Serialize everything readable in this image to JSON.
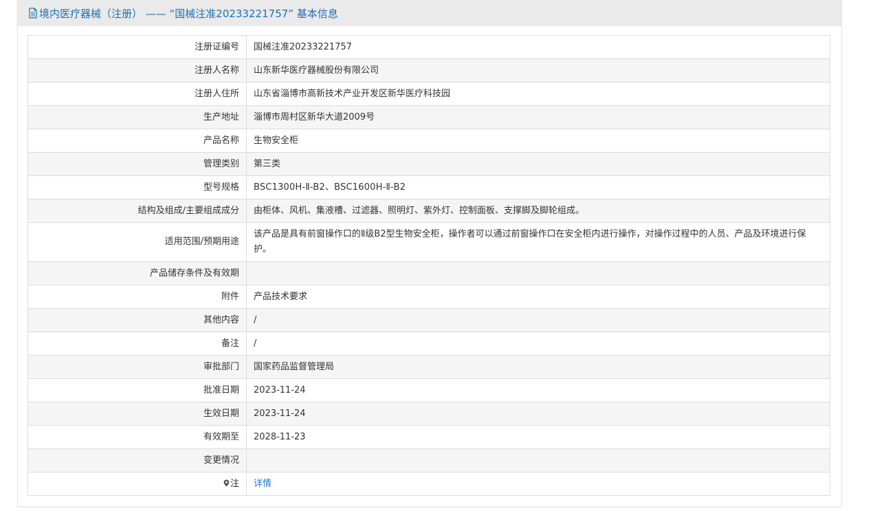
{
  "header": {
    "icon": "document-icon",
    "title": "境内医疗器械（注册） —— “国械注准20233221757” 基本信息"
  },
  "rows": [
    {
      "label": "注册证编号",
      "value": "国械注准20233221757"
    },
    {
      "label": "注册人名称",
      "value": "山东新华医疗器械股份有限公司"
    },
    {
      "label": "注册人住所",
      "value": "山东省淄博市高新技术产业开发区新华医疗科技园"
    },
    {
      "label": "生产地址",
      "value": "淄博市周村区新华大道2009号"
    },
    {
      "label": "产品名称",
      "value": "生物安全柜"
    },
    {
      "label": "管理类别",
      "value": "第三类"
    },
    {
      "label": "型号规格",
      "value": "BSC1300H-Ⅱ-B2、BSC1600H-Ⅱ-B2"
    },
    {
      "label": "结构及组成/主要组成成分",
      "value": "由柜体、风机、集液槽、过滤器、照明灯、紫外灯、控制面板、支撑脚及脚轮组成。"
    },
    {
      "label": "适用范围/预期用途",
      "value": "该产品是具有前窗操作口的Ⅱ级B2型生物安全柜，操作者可以通过前窗操作口在安全柜内进行操作，对操作过程中的人员、产品及环境进行保护。"
    },
    {
      "label": "产品储存条件及有效期",
      "value": ""
    },
    {
      "label": "附件",
      "value": "产品技术要求"
    },
    {
      "label": "其他内容",
      "value": "/"
    },
    {
      "label": "备注",
      "value": "/"
    },
    {
      "label": "审批部门",
      "value": "国家药品监督管理局"
    },
    {
      "label": "批准日期",
      "value": "2023-11-24"
    },
    {
      "label": "生效日期",
      "value": "2023-11-24"
    },
    {
      "label": "有效期至",
      "value": "2028-11-23"
    },
    {
      "label": "变更情况",
      "value": ""
    }
  ],
  "note_row": {
    "icon": "pin-icon",
    "label": "注",
    "link_text": "详情"
  },
  "colors": {
    "header_bg": "#eaeaea",
    "header_text": "#1f6fb2",
    "link": "#1f7ad6",
    "row_alt": "#f5f5f5",
    "border": "#dcdcdc"
  }
}
